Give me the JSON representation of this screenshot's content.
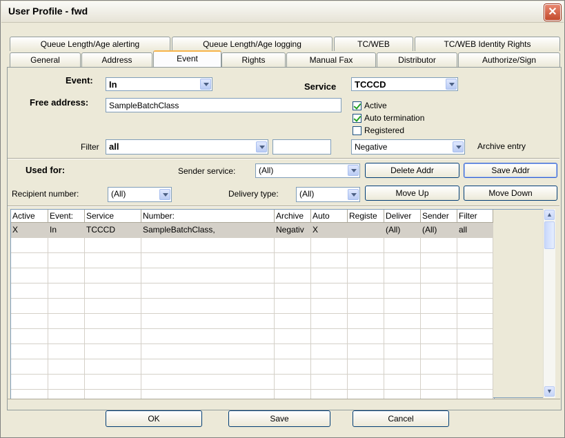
{
  "window": {
    "title": "User Profile - fwd",
    "close_glyph": "✕"
  },
  "tabs_row1": [
    "Queue Length/Age alerting",
    "Queue Length/Age logging",
    "TC/WEB",
    "TC/WEB Identity Rights"
  ],
  "tabs_row2": [
    "General",
    "Address",
    "Event",
    "Rights",
    "Manual Fax",
    "Distributor",
    "Authorize/Sign"
  ],
  "event_section": {
    "event_label": "Event:",
    "event_value": "In",
    "service_label": "Service",
    "service_value": "TCCCD",
    "free_address_label": "Free address:",
    "free_address_value": "SampleBatchClass",
    "active_label": "Active",
    "auto_termination_label": "Auto termination",
    "registered_label": "Registered",
    "filter_label": "Filter",
    "filter_value": "all",
    "filter_extra_value": "",
    "archive_value": "Negative",
    "archive_label": "Archive entry"
  },
  "used_for": {
    "label": "Used for:",
    "sender_service_label": "Sender service:",
    "sender_service_value": "(All)",
    "recipient_number_label": "Recipient number:",
    "recipient_number_value": "(All)",
    "delivery_type_label": "Delivery type:",
    "delivery_type_value": "(All)",
    "delete_addr": "Delete Addr",
    "save_addr": "Save Addr",
    "move_up": "Move Up",
    "move_down": "Move Down"
  },
  "grid": {
    "headers": [
      "Active",
      "Event:",
      "Service",
      "Number:",
      "Archive",
      "Auto",
      "Registe",
      "Deliver",
      "Sender",
      "Filter"
    ],
    "rows": [
      [
        "X",
        "In",
        "TCCCD",
        "SampleBatchClass,",
        "Negativ",
        "X",
        "",
        "(All)",
        "(All)",
        "all"
      ]
    ]
  },
  "footer": {
    "ok": "OK",
    "save": "Save",
    "cancel": "Cancel"
  },
  "colors": {
    "selected_row": "#d4d0c8",
    "tab_highlight": "#f7b34a",
    "close_button": "#c34b2c"
  }
}
